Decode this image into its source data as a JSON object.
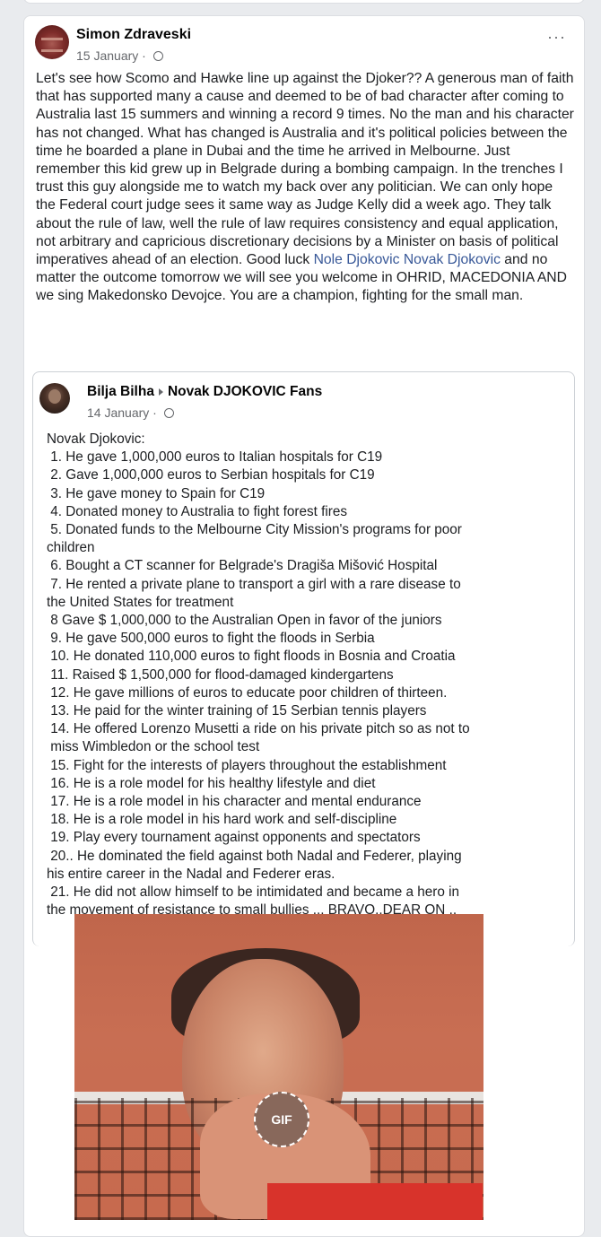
{
  "post": {
    "author": "Simon Zdraveski",
    "date": "15 January",
    "dot": "·",
    "more_label": "···",
    "text_before_link": "Let's see how Scomo and Hawke line up against the Djoker?? A generous man of faith that has supported many a cause and deemed to be of bad character after coming to Australia last 15 summers and winning a record 9 times. No the man and his character has not changed. What has changed is Australia and it's political policies between the time he boarded a plane in Dubai and the time he arrived in Melbourne. Just remember this kid grew up in Belgrade during a bombing campaign. In the trenches I trust this guy alongside me to watch my back over any politician. We can only hope the Federal court judge sees it same way as Judge Kelly did a week ago. They talk about the rule of law, well the rule of law requires consistency and equal application, not arbitrary and capricious discretionary decisions by a Minister on basis of political imperatives ahead of an election. Good luck ",
    "link_text": "Nole Djokovic Novak Djokovic",
    "text_after_link": " and no matter the outcome tomorrow we will see you welcome in OHRID, MACEDONIA AND we sing Makedonsko Devojce. You are a champion, fighting for the small man."
  },
  "shared": {
    "author": "Bilja Bilha",
    "group": "Novak DJOKOVIC Fans",
    "date": "14 January",
    "dot": "·",
    "lines": [
      "Novak Djokovic:",
      " 1. He gave 1,000,000 euros to Italian hospitals for C19",
      " 2. Gave 1,000,000 euros to Serbian hospitals for C19",
      " 3. He gave money to Spain for C19",
      " 4. Donated money to Australia to fight forest fires",
      " 5. Donated funds to the Melbourne City Mission's programs for poor",
      "children",
      " 6. Bought a CT scanner for Belgrade's Dragiša Mišović Hospital",
      " 7. He rented a private plane to transport a girl with a rare disease to",
      "the United States for treatment",
      " 8 Gave $ 1,000,000 to the Australian Open in favor of the juniors",
      " 9. He gave 500,000 euros to fight the floods in Serbia",
      " 10. He donated 110,000 euros to fight floods in Bosnia and Croatia",
      " 11. Raised $ 1,500,000 for flood-damaged kindergartens",
      " 12. He gave millions of euros to educate poor children of thirteen.",
      " 13. He paid for the winter training of 15 Serbian tennis players",
      " 14. He offered Lorenzo Musetti a ride on his private pitch so as not to",
      " miss Wimbledon or the school test",
      " 15. Fight for the interests of players throughout the establishment",
      " 16. He is a role model for his healthy lifestyle and diet",
      " 17. He is a role model in his character and mental endurance",
      " 18. He is a role model in his hard work and self-discipline",
      " 19. Play every tournament against opponents and spectators",
      " 20.. He dominated the field against both Nadal and Federer, playing",
      "his entire career in the Nadal and Federer eras.",
      " 21. He did not allow himself to be intimidated and became a hero in",
      "the movement of resistance to small bullies ... BRAVO..DEAR ON .."
    ]
  },
  "media": {
    "gif_badge": "GIF"
  }
}
